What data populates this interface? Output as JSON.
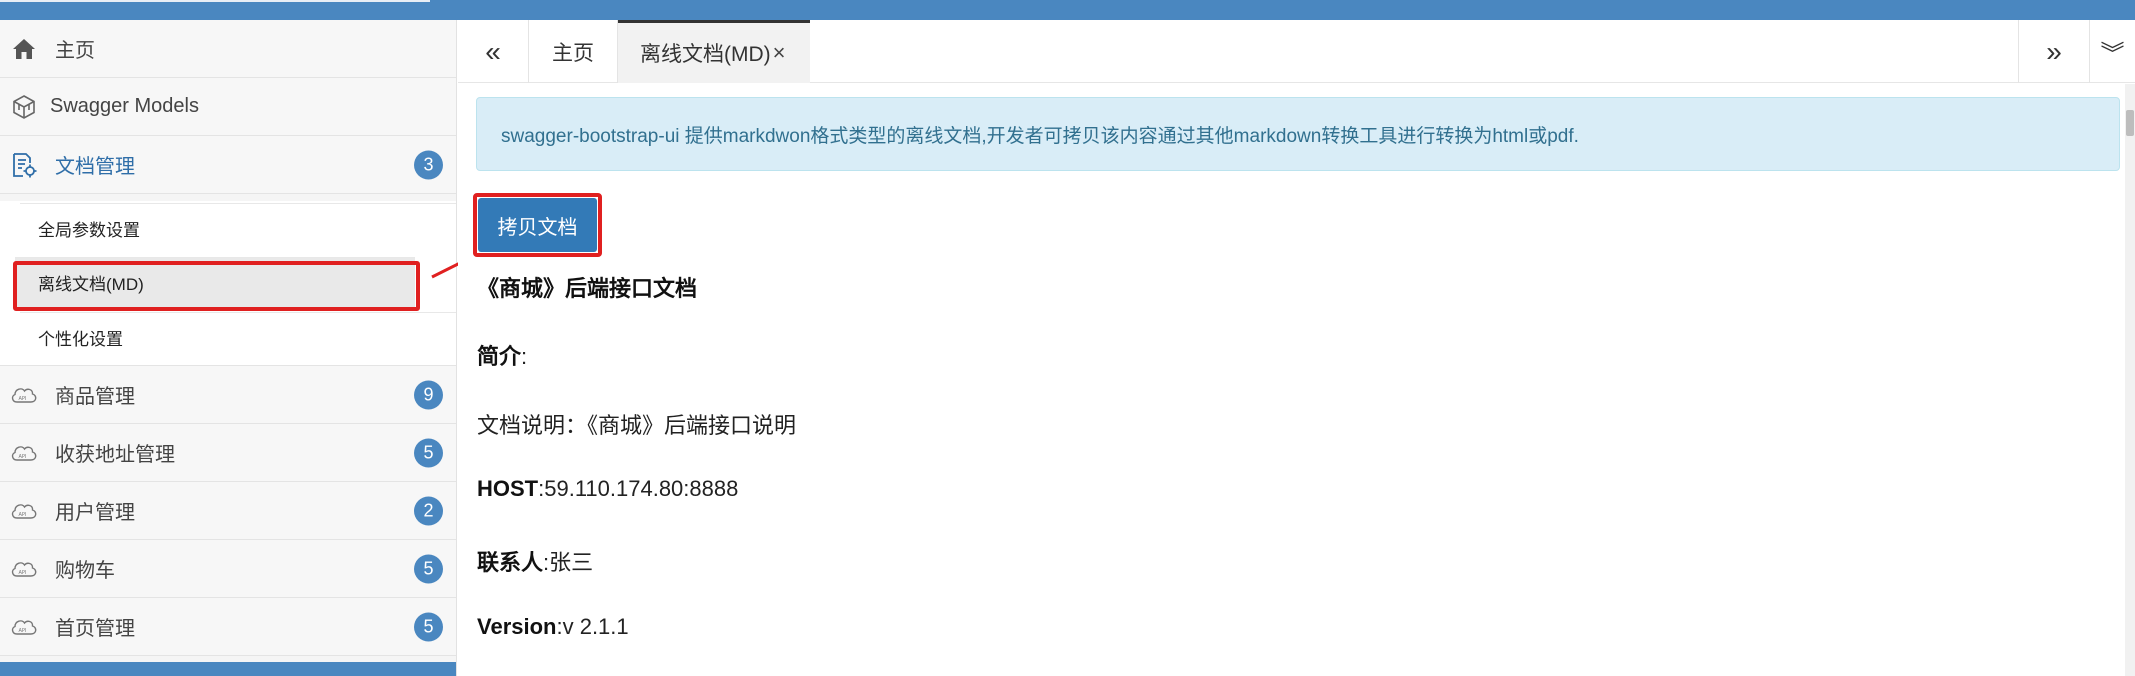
{
  "colors": {
    "primary": "#4a87c0",
    "button": "#337ab7",
    "highlight": "#e02020",
    "alert_bg": "#d9edf7",
    "alert_text": "#31708f"
  },
  "sidebar": {
    "items": [
      {
        "label": "主页",
        "icon": "home-icon"
      },
      {
        "label": "Swagger Models",
        "icon": "cube-icon"
      },
      {
        "label": "文档管理",
        "icon": "doc-gear-icon",
        "badge": "3"
      },
      {
        "label": "商品管理",
        "icon": "api-cloud-icon",
        "badge": "9"
      },
      {
        "label": "收获地址管理",
        "icon": "api-cloud-icon",
        "badge": "5"
      },
      {
        "label": "用户管理",
        "icon": "api-cloud-icon",
        "badge": "2"
      },
      {
        "label": "购物车",
        "icon": "api-cloud-icon",
        "badge": "5"
      },
      {
        "label": "首页管理",
        "icon": "api-cloud-icon",
        "badge": "5"
      }
    ],
    "submenu": [
      {
        "label": "全局参数设置"
      },
      {
        "label": "离线文档(MD)"
      },
      {
        "label": "个性化设置"
      }
    ]
  },
  "tabs": {
    "prev_label": "«",
    "next_label": "»",
    "more_label": "︾",
    "items": [
      {
        "label": "主页"
      },
      {
        "label": "离线文档(MD)",
        "close": "×"
      }
    ]
  },
  "content": {
    "info": "swagger-bootstrap-ui 提供markdwon格式类型的离线文档,开发者可拷贝该内容通过其他markdown转换工具进行转换为html或pdf.",
    "copy_button": "拷贝文档",
    "doc_title": "《商城》后端接口文档",
    "intro_label": "简介",
    "intro_sep": ":",
    "desc": "文档说明：《商城》后端接口说明",
    "host_label": "HOST",
    "host_value": ":59.110.174.80:8888",
    "contact_label": "联系人",
    "contact_value": ":张三",
    "version_label": "Version",
    "version_value": ":v 2.1.1"
  }
}
